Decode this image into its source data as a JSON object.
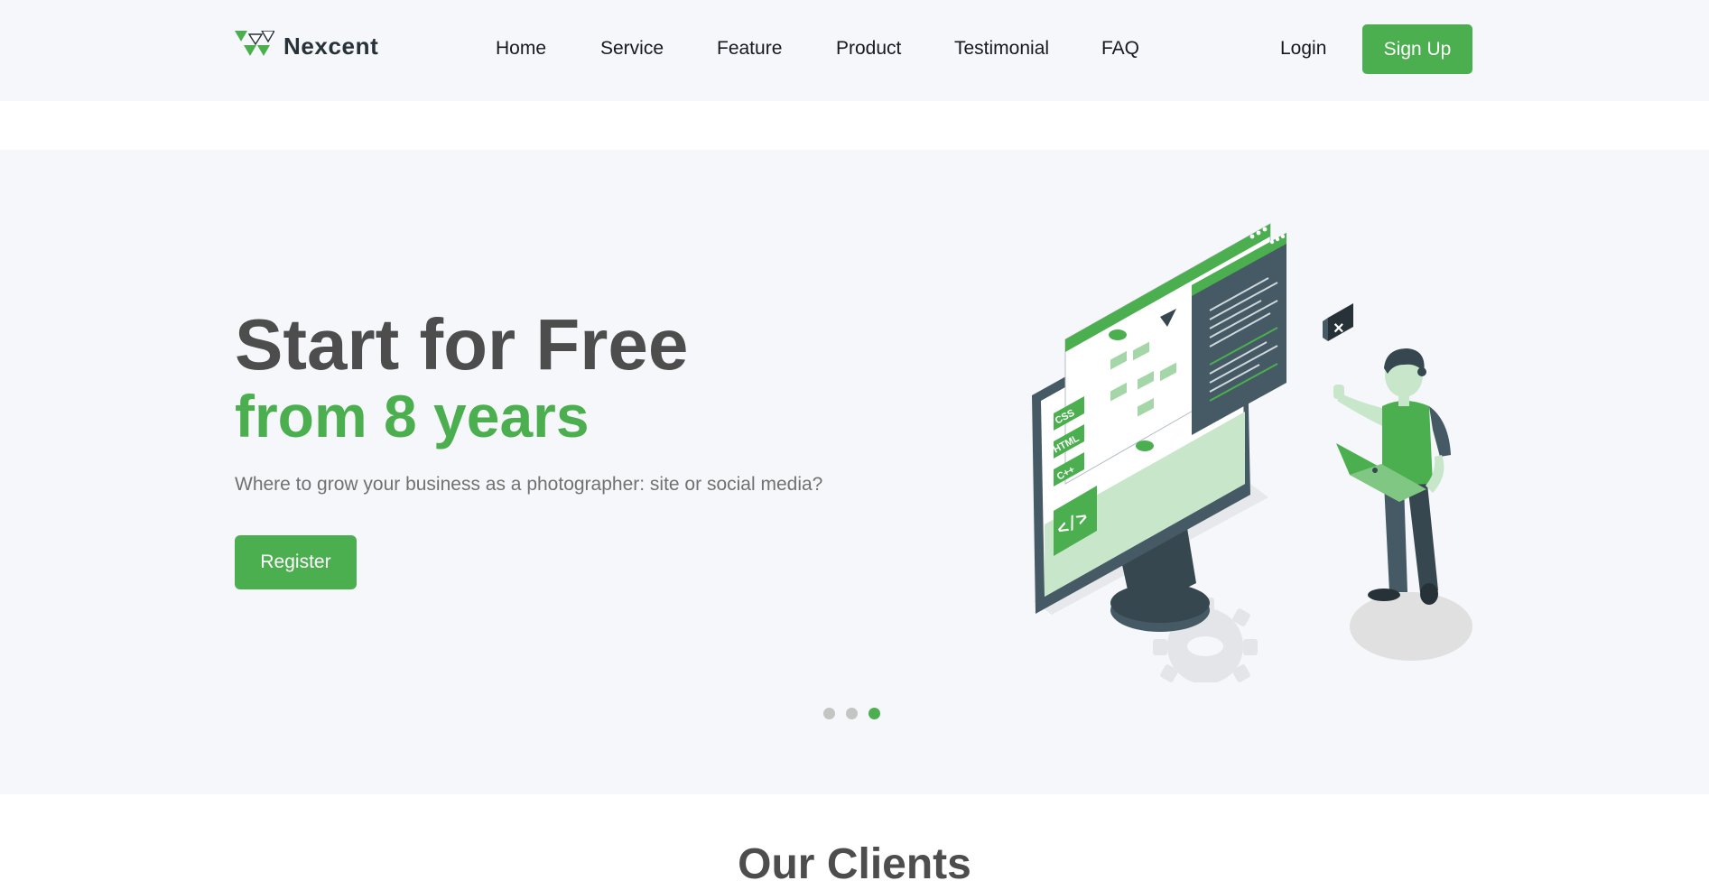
{
  "brand": {
    "name": "Nexcent",
    "logo_icon": "triangles-logo-icon"
  },
  "nav": {
    "items": [
      "Home",
      "Service",
      "Feature",
      "Product",
      "Testimonial",
      "FAQ"
    ],
    "login_label": "Login",
    "signup_label": "Sign Up"
  },
  "hero": {
    "title": "Start for Free",
    "subtitle": "from 8 years",
    "description": "Where to grow your business as a photographer: site or social media?",
    "cta_label": "Register",
    "illustration_icon": "developer-at-computer-illustration",
    "code_tags": [
      "CSS",
      "HTML",
      "C++"
    ],
    "carousel": {
      "count": 3,
      "active_index": 2
    }
  },
  "clients": {
    "title": "Our Clients"
  },
  "colors": {
    "accent": "#4caf4f",
    "background": "#f5f7fa",
    "heading": "#4d4d4d",
    "text_muted": "#717171",
    "dark": "#263238"
  }
}
